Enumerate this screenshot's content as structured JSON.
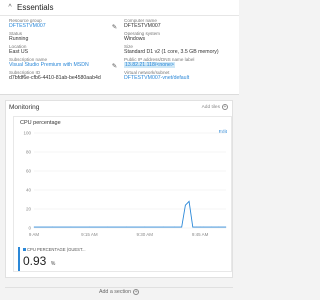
{
  "essentials": {
    "title": "Essentials",
    "left": [
      {
        "label": "Resource group",
        "value": "DFTESTVM007",
        "link": true
      },
      {
        "label": "Status",
        "value": "Running",
        "link": false
      },
      {
        "label": "Location",
        "value": "East US",
        "link": false
      },
      {
        "label": "Subscription name",
        "value": "Visual Studio Premium with MSDN",
        "link": true
      },
      {
        "label": "Subscription ID",
        "value": "d7bfdf6e-cfb6-4410-81ab-be4580aab4d",
        "link": false
      }
    ],
    "right": [
      {
        "label": "Computer name",
        "value": "DFTESTVM007",
        "link": false
      },
      {
        "label": "Operating system",
        "value": "Windows",
        "link": false
      },
      {
        "label": "Size",
        "value": "Standard D1 v2 (1 core, 3.5 GB memory)",
        "link": false
      },
      {
        "label": "Public IP address/DNS name label",
        "value": "13.82.21.118/<none>",
        "link": true,
        "highlight": true
      },
      {
        "label": "Virtual network/subnet",
        "value": "DFTESTVM007-vnet/default",
        "link": true
      }
    ]
  },
  "monitoring": {
    "title": "Monitoring",
    "add_tiles_label": "Add tiles"
  },
  "chart": {
    "title": "CPU percentage",
    "edit_label": "Edit",
    "metric_label": "CPU PERCENTAGE (GUEST...",
    "metric_value": "0.93",
    "metric_unit": "%"
  },
  "chart_data": {
    "type": "line",
    "title": "CPU percentage",
    "x_tick_labels": [
      "9 AM",
      "9:15 AM",
      "9:30 AM",
      "9:45 AM"
    ],
    "y_tick_labels": [
      "100",
      "80",
      "60",
      "40",
      "20",
      "0"
    ],
    "ylim": [
      0,
      100
    ],
    "grid": true,
    "series": [
      {
        "name": "CPU PERCENTAGE (GUEST...",
        "color": "#2b88d8",
        "x_minutes": [
          0,
          5,
          10,
          15,
          20,
          25,
          30,
          35,
          38,
          40,
          41,
          42,
          43,
          44,
          45,
          46,
          48,
          50,
          52
        ],
        "values": [
          1,
          1,
          1,
          1,
          1,
          1,
          1,
          1,
          1,
          1,
          24,
          28,
          1,
          1,
          1,
          1,
          1,
          1,
          1
        ]
      }
    ]
  },
  "add_section_label": "Add a section"
}
